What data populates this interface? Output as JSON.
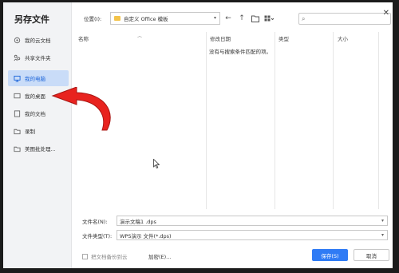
{
  "dialog": {
    "title": "另存文件"
  },
  "sidebar": {
    "items": [
      {
        "label": "我的云文档",
        "icon": "cloud-doc-icon",
        "active": false
      },
      {
        "label": "共享文件夹",
        "icon": "share-folder-icon",
        "active": false
      },
      {
        "label": "我的电脑",
        "icon": "computer-icon",
        "active": true
      },
      {
        "label": "我的桌面",
        "icon": "desktop-icon",
        "active": false
      },
      {
        "label": "我的文档",
        "icon": "document-icon",
        "active": false
      },
      {
        "label": "录制",
        "icon": "record-icon",
        "active": false
      },
      {
        "label": "美图批处理...",
        "icon": "folder-icon",
        "active": false
      }
    ]
  },
  "toolbar": {
    "location_label": "位置(I):",
    "location_value": "自定义 Office 模板",
    "back_icon": "←",
    "up_icon": "↑",
    "new_folder_icon": "new-folder-icon",
    "view_icon": "view-grid-icon",
    "search_placeholder": "",
    "close_icon": "✕"
  },
  "filelist": {
    "columns": [
      "名称",
      "修改日期",
      "类型",
      "大小"
    ],
    "empty_message": "没有与搜索条件匹配的项。"
  },
  "bottom": {
    "filename_label": "文件名(N):",
    "filename_value": "演示文稿1 .dps",
    "filetype_label": "文件类型(T):",
    "filetype_value": "WPS演示 文件(*.dps)",
    "backup_label": "把文档备份到云",
    "encrypt_label": "加密(E)...",
    "save_label": "保存(S)",
    "cancel_label": "取消"
  },
  "colors": {
    "accent": "#2f7bf5",
    "active_bg": "#c9dcf8",
    "arrow": "#e8231f"
  }
}
